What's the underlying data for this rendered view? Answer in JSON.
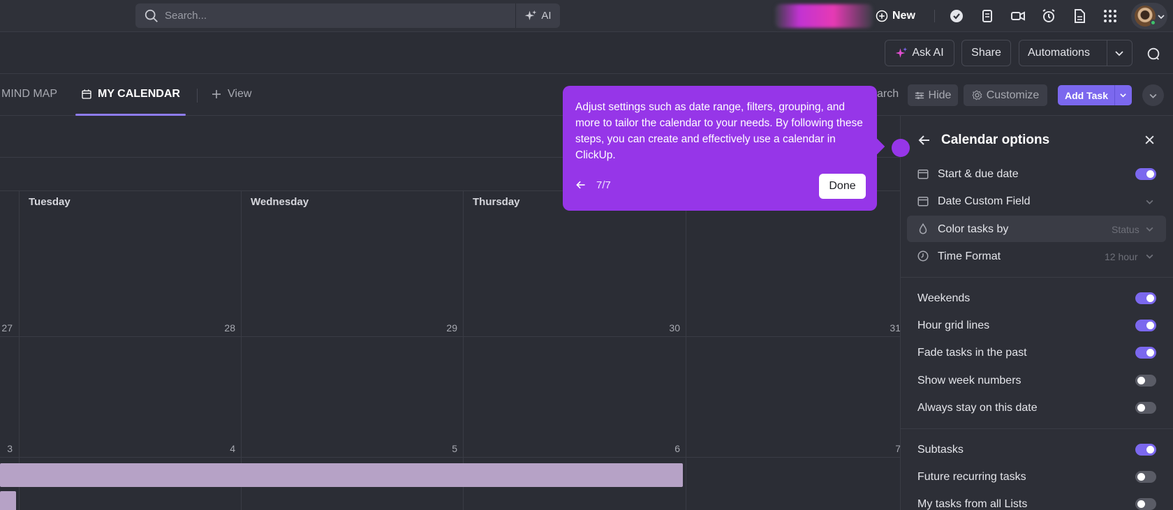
{
  "topbar": {
    "search_placeholder": "Search...",
    "ai_label": "AI",
    "new_label": "New"
  },
  "header": {
    "ask_ai": "Ask AI",
    "share": "Share",
    "automations": "Automations"
  },
  "views": {
    "tab_mindmap": "MIND MAP",
    "tab_calendar": "MY CALENDAR",
    "add_view": "View",
    "search_fragment": "arch",
    "hide": "Hide",
    "customize": "Customize",
    "add_task": "Add Task"
  },
  "calendar": {
    "days": [
      "Tuesday",
      "Wednesday",
      "Thursday"
    ],
    "week1_numbers": [
      "27",
      "28",
      "29",
      "30",
      "31"
    ],
    "week2_numbers": [
      "3",
      "4",
      "5",
      "6",
      "7"
    ]
  },
  "tooltip": {
    "text": "Adjust settings such as date range, filters, grouping, and more to tailor the calendar to your needs. By following these steps, you can create and effectively use a calendar in ClickUp.",
    "step": "7/7",
    "done": "Done"
  },
  "panel": {
    "title": "Calendar options",
    "start_due": "Start & due date",
    "date_custom_field": "Date Custom Field",
    "color_tasks_by": "Color tasks by",
    "color_tasks_value": "Status",
    "time_format": "Time Format",
    "time_format_value": "12 hour",
    "weekends": "Weekends",
    "hour_grid_lines": "Hour grid lines",
    "fade_past": "Fade tasks in the past",
    "week_numbers": "Show week numbers",
    "stay_on_date": "Always stay on this date",
    "subtasks": "Subtasks",
    "future_recurring": "Future recurring tasks",
    "my_tasks_all_lists": "My tasks from all Lists"
  },
  "colors": {
    "accent": "#7b68ee",
    "tooltip": "#9636e8",
    "event_bar": "#b6a2c6"
  }
}
